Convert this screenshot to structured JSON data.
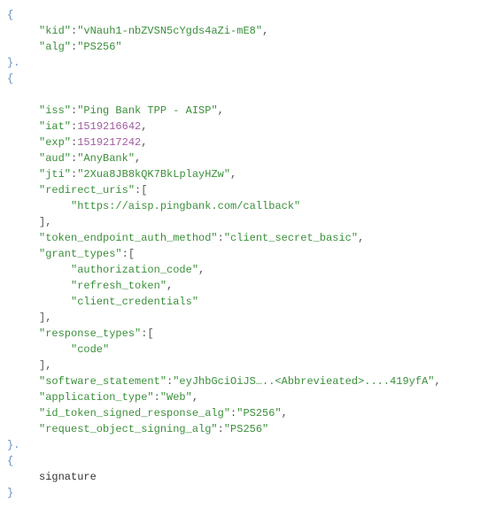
{
  "header": {
    "kid_key": "\"kid\"",
    "kid_val": "\"vNauh1-nbZVSN5cYgds4aZi-mE8\"",
    "alg_key": "\"alg\"",
    "alg_val": "\"PS256\""
  },
  "payload": {
    "iss_key": "\"iss\"",
    "iss_val": "\"Ping Bank TPP - AISP\"",
    "iat_key": "\"iat\"",
    "iat_val": "1519216642",
    "exp_key": "\"exp\"",
    "exp_val": "1519217242",
    "aud_key": "\"aud\"",
    "aud_val": "\"AnyBank\"",
    "jti_key": "\"jti\"",
    "jti_val": "\"2Xua8JB8kQK7BkLplayHZw\"",
    "redirect_uris_key": "\"redirect_uris\"",
    "redirect_uris_0": "\"https://aisp.pingbank.com/callback\"",
    "team_key": "\"token_endpoint_auth_method\"",
    "team_val": "\"client_secret_basic\"",
    "grant_types_key": "\"grant_types\"",
    "grant_types_0": "\"authorization_code\"",
    "grant_types_1": "\"refresh_token\"",
    "grant_types_2": "\"client_credentials\"",
    "response_types_key": "\"response_types\"",
    "response_types_0": "\"code\"",
    "software_statement_key": "\"software_statement\"",
    "software_statement_val": "\"eyJhbGciOiJS…..<Abbrevieated>....419yfA\"",
    "application_type_key": "\"application_type\"",
    "application_type_val": "\"Web\"",
    "itsra_key": "\"id_token_signed_response_alg\"",
    "itsra_val": "\"PS256\"",
    "rosa_key": "\"request_object_signing_alg\"",
    "rosa_val": "\"PS256\""
  },
  "signature_label": "signature",
  "braces": {
    "open": "{",
    "close": "}",
    "close_dot": "}."
  },
  "p": {
    "colon": ":",
    "comma": ",",
    "obrk": "[",
    "cbrk": "]",
    "cbrkc": "],",
    "gap": "     "
  }
}
